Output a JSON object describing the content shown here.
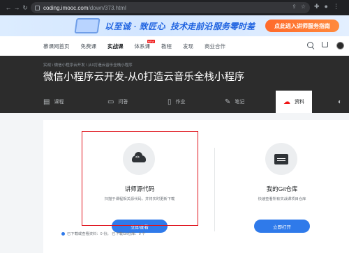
{
  "browser": {
    "url_host": "coding.imooc.com",
    "url_path": "/down/373.html"
  },
  "banner": {
    "slogan_1": "以至诚 · 致匠心",
    "slogan_2": "技术走前沿",
    "slogan_3": "服务零时差",
    "cta": "点此进入讲师服务指南"
  },
  "nav": {
    "items": [
      {
        "label": "慕课网首页",
        "active": false,
        "badge": ""
      },
      {
        "label": "免费课",
        "active": false,
        "badge": ""
      },
      {
        "label": "实战课",
        "active": true,
        "badge": ""
      },
      {
        "label": "体系课",
        "active": false,
        "badge": "NEW"
      },
      {
        "label": "教程",
        "active": false,
        "badge": ""
      },
      {
        "label": "发现",
        "active": false,
        "badge": ""
      },
      {
        "label": "商业合作",
        "active": false,
        "badge": ""
      }
    ]
  },
  "hero": {
    "breadcrumb": "实战 \\ 微信小程序云开发 \\ 从0打造云音乐全栈小程序",
    "title": "微信小程序云开发-从0打造云音乐全栈小程序"
  },
  "tabs": [
    {
      "label": "课程",
      "icon": "course-icon"
    },
    {
      "label": "问答",
      "icon": "qa-icon"
    },
    {
      "label": "作业",
      "icon": "homework-icon"
    },
    {
      "label": "笔记",
      "icon": "note-icon"
    },
    {
      "label": "资料",
      "icon": "cloud-icon",
      "active": true
    }
  ],
  "cards": {
    "source": {
      "title": "讲师源代码",
      "desc": "扫描于课程相关源代码，并将实时更新下载",
      "button": "立即查看"
    },
    "git": {
      "title": "我的Git仓库",
      "desc": "快速查看所有实战课项目仓库",
      "button": "立即打开"
    }
  },
  "footnote": "已下载或查看资料：0 份；  已下载Git仓库：0 个",
  "colors": {
    "accent": "#2f7aea",
    "active_tab_icon": "#f01414",
    "highlight_border": "#e0141c"
  }
}
